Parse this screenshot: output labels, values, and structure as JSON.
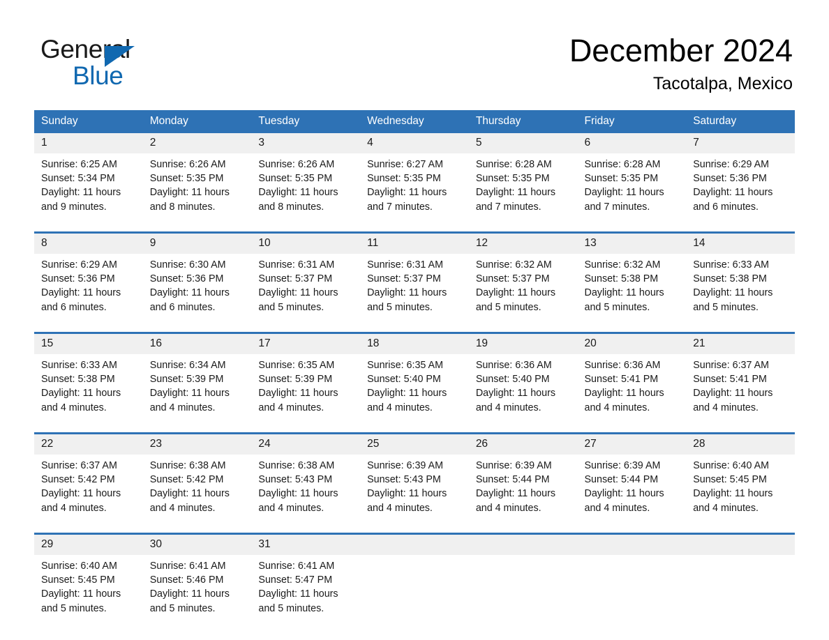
{
  "brand": {
    "name_top": "General",
    "name_bottom": "Blue",
    "triangle_color": "#1068b0",
    "text_color": "#1a1a1a"
  },
  "header": {
    "title": "December 2024",
    "subtitle": "Tacotalpa, Mexico"
  },
  "theme": {
    "header_blue": "#2e72b5",
    "daynum_gray": "#f0f0f0",
    "text": "#1a1a1a",
    "background": "#ffffff"
  },
  "calendar": {
    "weekday_headers": [
      "Sunday",
      "Monday",
      "Tuesday",
      "Wednesday",
      "Thursday",
      "Friday",
      "Saturday"
    ],
    "weeks": [
      [
        {
          "day": "1",
          "sunrise": "Sunrise: 6:25 AM",
          "sunset": "Sunset: 5:34 PM",
          "daylight_line1": "Daylight: 11 hours",
          "daylight_line2": "and 9 minutes."
        },
        {
          "day": "2",
          "sunrise": "Sunrise: 6:26 AM",
          "sunset": "Sunset: 5:35 PM",
          "daylight_line1": "Daylight: 11 hours",
          "daylight_line2": "and 8 minutes."
        },
        {
          "day": "3",
          "sunrise": "Sunrise: 6:26 AM",
          "sunset": "Sunset: 5:35 PM",
          "daylight_line1": "Daylight: 11 hours",
          "daylight_line2": "and 8 minutes."
        },
        {
          "day": "4",
          "sunrise": "Sunrise: 6:27 AM",
          "sunset": "Sunset: 5:35 PM",
          "daylight_line1": "Daylight: 11 hours",
          "daylight_line2": "and 7 minutes."
        },
        {
          "day": "5",
          "sunrise": "Sunrise: 6:28 AM",
          "sunset": "Sunset: 5:35 PM",
          "daylight_line1": "Daylight: 11 hours",
          "daylight_line2": "and 7 minutes."
        },
        {
          "day": "6",
          "sunrise": "Sunrise: 6:28 AM",
          "sunset": "Sunset: 5:35 PM",
          "daylight_line1": "Daylight: 11 hours",
          "daylight_line2": "and 7 minutes."
        },
        {
          "day": "7",
          "sunrise": "Sunrise: 6:29 AM",
          "sunset": "Sunset: 5:36 PM",
          "daylight_line1": "Daylight: 11 hours",
          "daylight_line2": "and 6 minutes."
        }
      ],
      [
        {
          "day": "8",
          "sunrise": "Sunrise: 6:29 AM",
          "sunset": "Sunset: 5:36 PM",
          "daylight_line1": "Daylight: 11 hours",
          "daylight_line2": "and 6 minutes."
        },
        {
          "day": "9",
          "sunrise": "Sunrise: 6:30 AM",
          "sunset": "Sunset: 5:36 PM",
          "daylight_line1": "Daylight: 11 hours",
          "daylight_line2": "and 6 minutes."
        },
        {
          "day": "10",
          "sunrise": "Sunrise: 6:31 AM",
          "sunset": "Sunset: 5:37 PM",
          "daylight_line1": "Daylight: 11 hours",
          "daylight_line2": "and 5 minutes."
        },
        {
          "day": "11",
          "sunrise": "Sunrise: 6:31 AM",
          "sunset": "Sunset: 5:37 PM",
          "daylight_line1": "Daylight: 11 hours",
          "daylight_line2": "and 5 minutes."
        },
        {
          "day": "12",
          "sunrise": "Sunrise: 6:32 AM",
          "sunset": "Sunset: 5:37 PM",
          "daylight_line1": "Daylight: 11 hours",
          "daylight_line2": "and 5 minutes."
        },
        {
          "day": "13",
          "sunrise": "Sunrise: 6:32 AM",
          "sunset": "Sunset: 5:38 PM",
          "daylight_line1": "Daylight: 11 hours",
          "daylight_line2": "and 5 minutes."
        },
        {
          "day": "14",
          "sunrise": "Sunrise: 6:33 AM",
          "sunset": "Sunset: 5:38 PM",
          "daylight_line1": "Daylight: 11 hours",
          "daylight_line2": "and 5 minutes."
        }
      ],
      [
        {
          "day": "15",
          "sunrise": "Sunrise: 6:33 AM",
          "sunset": "Sunset: 5:38 PM",
          "daylight_line1": "Daylight: 11 hours",
          "daylight_line2": "and 4 minutes."
        },
        {
          "day": "16",
          "sunrise": "Sunrise: 6:34 AM",
          "sunset": "Sunset: 5:39 PM",
          "daylight_line1": "Daylight: 11 hours",
          "daylight_line2": "and 4 minutes."
        },
        {
          "day": "17",
          "sunrise": "Sunrise: 6:35 AM",
          "sunset": "Sunset: 5:39 PM",
          "daylight_line1": "Daylight: 11 hours",
          "daylight_line2": "and 4 minutes."
        },
        {
          "day": "18",
          "sunrise": "Sunrise: 6:35 AM",
          "sunset": "Sunset: 5:40 PM",
          "daylight_line1": "Daylight: 11 hours",
          "daylight_line2": "and 4 minutes."
        },
        {
          "day": "19",
          "sunrise": "Sunrise: 6:36 AM",
          "sunset": "Sunset: 5:40 PM",
          "daylight_line1": "Daylight: 11 hours",
          "daylight_line2": "and 4 minutes."
        },
        {
          "day": "20",
          "sunrise": "Sunrise: 6:36 AM",
          "sunset": "Sunset: 5:41 PM",
          "daylight_line1": "Daylight: 11 hours",
          "daylight_line2": "and 4 minutes."
        },
        {
          "day": "21",
          "sunrise": "Sunrise: 6:37 AM",
          "sunset": "Sunset: 5:41 PM",
          "daylight_line1": "Daylight: 11 hours",
          "daylight_line2": "and 4 minutes."
        }
      ],
      [
        {
          "day": "22",
          "sunrise": "Sunrise: 6:37 AM",
          "sunset": "Sunset: 5:42 PM",
          "daylight_line1": "Daylight: 11 hours",
          "daylight_line2": "and 4 minutes."
        },
        {
          "day": "23",
          "sunrise": "Sunrise: 6:38 AM",
          "sunset": "Sunset: 5:42 PM",
          "daylight_line1": "Daylight: 11 hours",
          "daylight_line2": "and 4 minutes."
        },
        {
          "day": "24",
          "sunrise": "Sunrise: 6:38 AM",
          "sunset": "Sunset: 5:43 PM",
          "daylight_line1": "Daylight: 11 hours",
          "daylight_line2": "and 4 minutes."
        },
        {
          "day": "25",
          "sunrise": "Sunrise: 6:39 AM",
          "sunset": "Sunset: 5:43 PM",
          "daylight_line1": "Daylight: 11 hours",
          "daylight_line2": "and 4 minutes."
        },
        {
          "day": "26",
          "sunrise": "Sunrise: 6:39 AM",
          "sunset": "Sunset: 5:44 PM",
          "daylight_line1": "Daylight: 11 hours",
          "daylight_line2": "and 4 minutes."
        },
        {
          "day": "27",
          "sunrise": "Sunrise: 6:39 AM",
          "sunset": "Sunset: 5:44 PM",
          "daylight_line1": "Daylight: 11 hours",
          "daylight_line2": "and 4 minutes."
        },
        {
          "day": "28",
          "sunrise": "Sunrise: 6:40 AM",
          "sunset": "Sunset: 5:45 PM",
          "daylight_line1": "Daylight: 11 hours",
          "daylight_line2": "and 4 minutes."
        }
      ],
      [
        {
          "day": "29",
          "sunrise": "Sunrise: 6:40 AM",
          "sunset": "Sunset: 5:45 PM",
          "daylight_line1": "Daylight: 11 hours",
          "daylight_line2": "and 5 minutes."
        },
        {
          "day": "30",
          "sunrise": "Sunrise: 6:41 AM",
          "sunset": "Sunset: 5:46 PM",
          "daylight_line1": "Daylight: 11 hours",
          "daylight_line2": "and 5 minutes."
        },
        {
          "day": "31",
          "sunrise": "Sunrise: 6:41 AM",
          "sunset": "Sunset: 5:47 PM",
          "daylight_line1": "Daylight: 11 hours",
          "daylight_line2": "and 5 minutes."
        },
        {
          "day": "",
          "sunrise": "",
          "sunset": "",
          "daylight_line1": "",
          "daylight_line2": ""
        },
        {
          "day": "",
          "sunrise": "",
          "sunset": "",
          "daylight_line1": "",
          "daylight_line2": ""
        },
        {
          "day": "",
          "sunrise": "",
          "sunset": "",
          "daylight_line1": "",
          "daylight_line2": ""
        },
        {
          "day": "",
          "sunrise": "",
          "sunset": "",
          "daylight_line1": "",
          "daylight_line2": ""
        }
      ]
    ]
  }
}
